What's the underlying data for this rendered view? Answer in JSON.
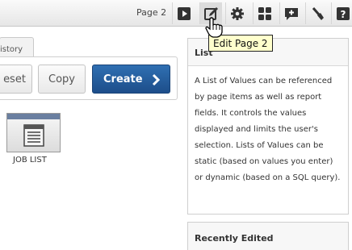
{
  "toolbar": {
    "page_label": "Page 2",
    "buttons": [
      {
        "name": "run-page-icon"
      },
      {
        "name": "edit-page-icon"
      },
      {
        "name": "settings-gear-icon"
      },
      {
        "name": "components-grid-icon"
      },
      {
        "name": "comment-add-icon"
      },
      {
        "name": "utilities-brush-icon"
      },
      {
        "name": "help-icon"
      }
    ]
  },
  "tooltip": {
    "text": "Edit Page 2"
  },
  "tab": {
    "label": "istory"
  },
  "buttons": {
    "reset": "eset",
    "copy": "Copy",
    "create": "Create"
  },
  "list_item": {
    "label": "JOB LIST"
  },
  "help": {
    "title": "List",
    "body": "A List of Values can be referenced by page items as well as report fields. It controls the values displayed and limits the user's selection. Lists of Values can be static (based on values you enter) or dynamic (based on a SQL query)."
  },
  "recently_edited": {
    "title": "Recently Edited"
  },
  "colors": {
    "create_button": "#1d4e8a",
    "tooltip_bg": "#ffffcc"
  }
}
